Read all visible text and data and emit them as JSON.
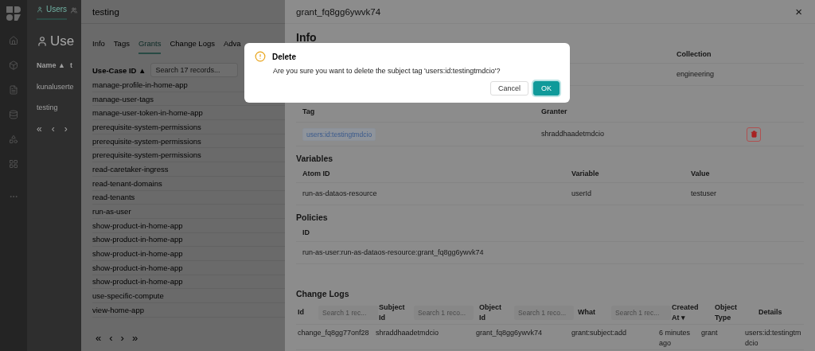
{
  "sidebar": {
    "items": [
      {
        "kind": "logo"
      },
      {
        "kind": "home",
        "selected": false
      },
      {
        "kind": "cube",
        "selected": false
      },
      {
        "kind": "file",
        "selected": false
      },
      {
        "kind": "database",
        "selected": false
      },
      {
        "kind": "shapes",
        "selected": false
      },
      {
        "kind": "grid",
        "selected": false
      },
      {
        "kind": "more",
        "selected": false
      }
    ]
  },
  "app": {
    "tabs": [
      {
        "label": "Users",
        "selected": true
      },
      {
        "selected": false
      }
    ],
    "heading": "Use",
    "columns": [
      "Name ▲",
      "t"
    ],
    "rows": [
      "kunaluserte",
      "testing"
    ],
    "pager": [
      "«",
      "‹",
      "›"
    ]
  },
  "user_drawer": {
    "title": "testing",
    "tabs": [
      {
        "label": "Info",
        "selected": false
      },
      {
        "label": "Tags",
        "selected": false
      },
      {
        "label": "Grants",
        "selected": true
      },
      {
        "label": "Change Logs",
        "selected": false
      },
      {
        "label": "Adva",
        "selected": false
      }
    ],
    "column": "Use-Case ID ▲",
    "search": {
      "placeholder": "Search 17 records..."
    },
    "rows": [
      "manage-profile-in-home-app",
      "manage-user-tags",
      "manage-user-token-in-home-app",
      "prerequisite-system-permissions",
      "prerequisite-system-permissions",
      "prerequisite-system-permissions",
      "read-caretaker-ingress",
      "read-tenant-domains",
      "read-tenants",
      "run-as-user",
      "show-product-in-home-app",
      "show-product-in-home-app",
      "show-product-in-home-app",
      "show-product-in-home-app",
      "show-product-in-home-app",
      "use-specific-compute",
      "view-home-app"
    ],
    "pager": [
      "«",
      "‹",
      "›",
      "»"
    ]
  },
  "grant_drawer": {
    "title": "grant_fq8gg6ywvk74",
    "close": "×",
    "info": {
      "heading": "Info",
      "column": "Collection",
      "value": "engineering"
    },
    "subjects": {
      "columns": [
        "Tag",
        "Granter"
      ],
      "rows": [
        {
          "tag": "users:id:testingtmdcio",
          "granter": "shraddhaadetmdcio"
        }
      ]
    },
    "variables": {
      "heading": "Variables",
      "columns": [
        "Atom ID",
        "Variable",
        "Value"
      ],
      "rows": [
        [
          "run-as-dataos-resource",
          "userId",
          "testuser"
        ]
      ]
    },
    "policies": {
      "heading": "Policies",
      "columns": [
        "ID"
      ],
      "rows": [
        "run-as-user:run-as-dataos-resource:grant_fq8gg6ywvk74"
      ]
    },
    "change_logs": {
      "heading": "Change Logs",
      "columns": [
        {
          "label": "Id",
          "placeholder": "Search 1 rec..."
        },
        {
          "label": "Subject Id",
          "placeholder": "Search 1 reco..."
        },
        {
          "label": "Object Id",
          "placeholder": "Search 1 reco..."
        },
        {
          "label": "What",
          "placeholder": "Search 1 rec..."
        },
        {
          "label": "Created At ▾"
        },
        {
          "label": "Object Type"
        },
        {
          "label": "Details"
        }
      ],
      "rows": [
        [
          "change_fq8gg77onf28",
          "shraddhaadetmdcio",
          "grant_fq8gg6ywvk74",
          "grant:subject:add",
          "6 minutes ago",
          "grant",
          "users:id:testingtmdcio"
        ]
      ]
    }
  },
  "dialog": {
    "title": "Delete",
    "message": "Are you sure you want to delete the subject tag 'users:id:testingtmdcio'?",
    "buttons": [
      {
        "label": "Cancel",
        "kind": "default"
      },
      {
        "label": "OK",
        "kind": "primary"
      }
    ]
  }
}
